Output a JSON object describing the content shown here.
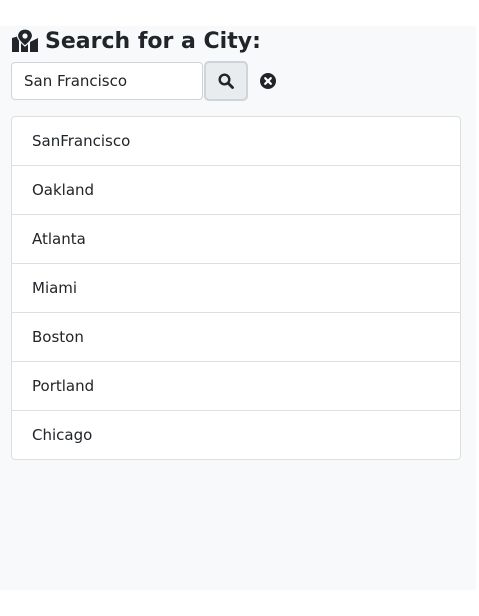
{
  "header": {
    "title": "Search for a City:",
    "icon": "map-marked-icon"
  },
  "search": {
    "value": "San Francisco",
    "search_icon": "search-icon",
    "clear_icon": "times-circle-icon"
  },
  "cities": [
    {
      "label": "SanFrancisco"
    },
    {
      "label": "Oakland"
    },
    {
      "label": "Atlanta"
    },
    {
      "label": "Miami"
    },
    {
      "label": "Boston"
    },
    {
      "label": "Portland"
    },
    {
      "label": "Chicago"
    }
  ]
}
